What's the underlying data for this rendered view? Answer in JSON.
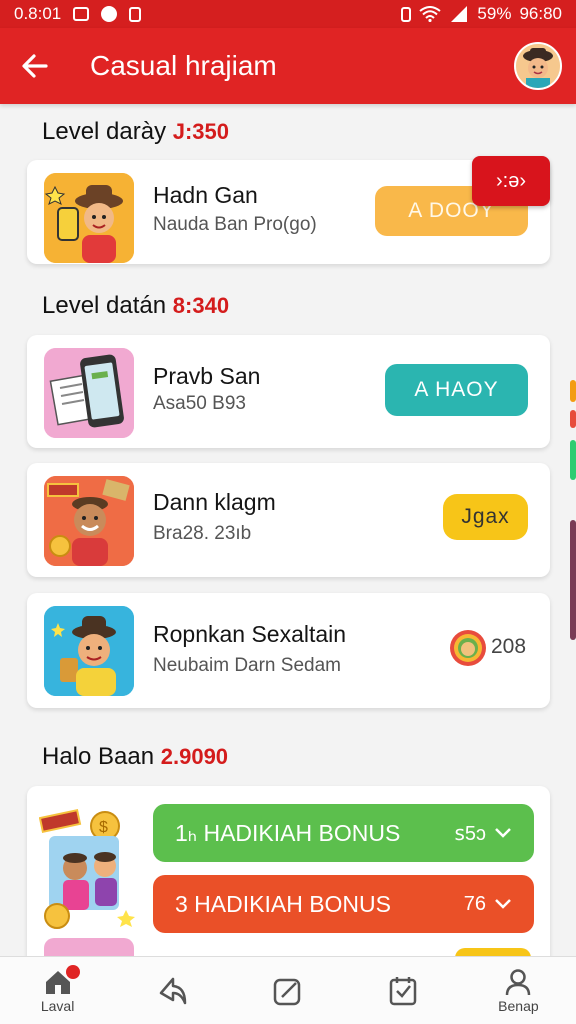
{
  "status": {
    "time": "0.8:01",
    "battery": "59%",
    "clock": "96:80"
  },
  "appbar": {
    "title": "Casual hrajiam"
  },
  "sections": [
    {
      "label": "Level darày",
      "num": "J:350"
    },
    {
      "label": "Level datán",
      "num": "8:340"
    },
    {
      "label": "Halo Baan",
      "num": "2.9090"
    }
  ],
  "cards": [
    {
      "title": "Hadn Gan",
      "sub": "Nauda Ban Pro(go)",
      "action": "A DOOY",
      "badge": "›:ə›"
    },
    {
      "title": "Pravb San",
      "sub": "Asa50 B93",
      "action": "A HAOY"
    },
    {
      "title": "Dann klagm",
      "sub": "Bra28. 23ıb",
      "action": "Jgax"
    },
    {
      "title": "Ropnkan Sexaltain",
      "sub": "Neubaim Darn Sedam",
      "action": "208"
    }
  ],
  "bonus": [
    {
      "label": "1ₕ HADIKIAH BONUS",
      "value": "ꜱ5ↄ"
    },
    {
      "label": "3 HADIKIAH BONUS",
      "value": "76"
    }
  ],
  "nav": [
    {
      "label": "Laval",
      "icon": "home-icon"
    },
    {
      "label": "",
      "icon": "share-icon"
    },
    {
      "label": "",
      "icon": "edit-icon"
    },
    {
      "label": "",
      "icon": "check-icon"
    },
    {
      "label": "Benap",
      "icon": "profile-icon"
    }
  ],
  "colors": {
    "primary": "#e02424",
    "orange": "#f9b84a",
    "teal": "#2bb5b0",
    "yellow": "#f7c518",
    "green": "#5cbf4d",
    "red_orange": "#ea5028"
  }
}
